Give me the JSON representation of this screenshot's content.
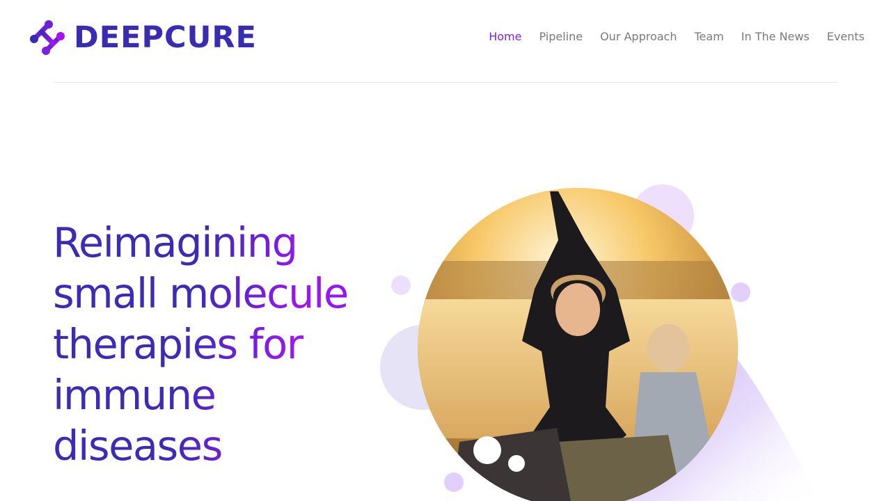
{
  "brand": {
    "name": "DEEPCURE",
    "colors": {
      "primary": "#3a2bb3",
      "accent": "#7e1fe4",
      "nav_text": "#7a7a7a"
    }
  },
  "nav": {
    "active": "Home",
    "items": [
      {
        "label": "Home"
      },
      {
        "label": "Pipeline"
      },
      {
        "label": "Our Approach"
      },
      {
        "label": "Team"
      },
      {
        "label": "In The News"
      },
      {
        "label": "Events"
      }
    ]
  },
  "hero": {
    "headline": "Reimagining small molecule therapies for immune diseases"
  }
}
